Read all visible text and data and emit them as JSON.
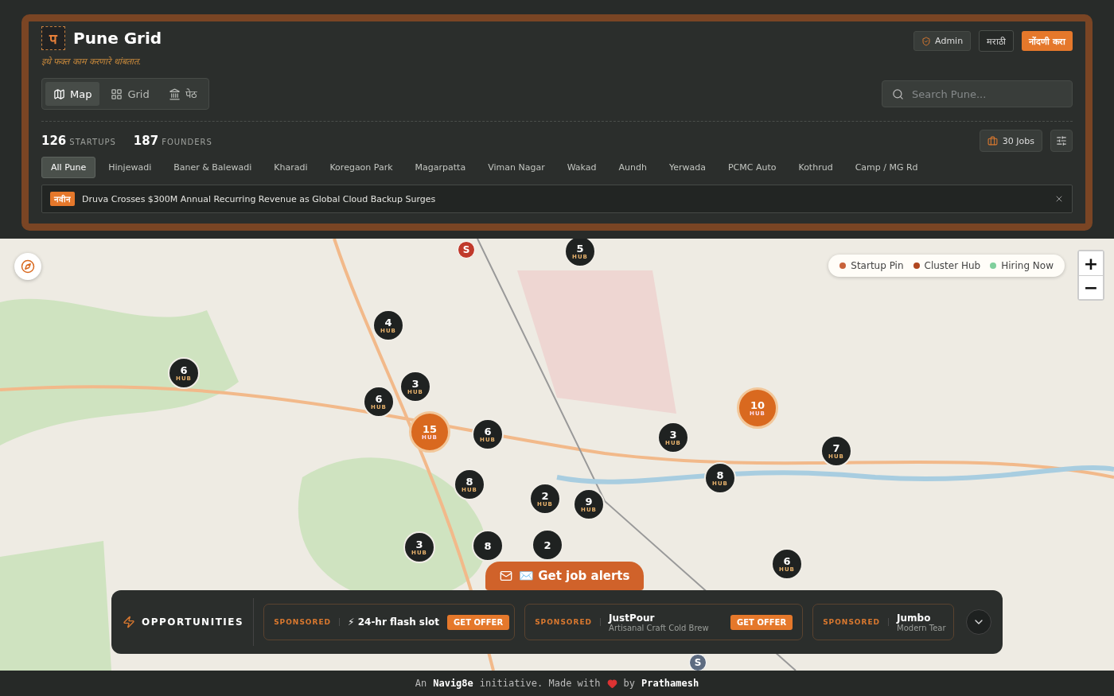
{
  "brand": {
    "logo_letter": "प",
    "name": "Pune Grid",
    "tagline": "इथे फक्त काम करणारे थांबतात."
  },
  "header_buttons": [
    {
      "label": "Admin",
      "kind": "admin"
    },
    {
      "label": "मराठी",
      "kind": "outline"
    },
    {
      "label": "नोंदणी करा",
      "kind": "primary"
    }
  ],
  "view_tabs": [
    {
      "label": "Map",
      "selected": true
    },
    {
      "label": "Grid",
      "selected": false
    },
    {
      "label": "पेठ",
      "selected": false
    }
  ],
  "search": {
    "placeholder": "Search Pune..."
  },
  "stats": [
    {
      "value": "126",
      "label": "STARTUPS"
    },
    {
      "value": "187",
      "label": "FOUNDERS"
    }
  ],
  "jobs_button": "30 Jobs",
  "areas": [
    {
      "label": "All Pune",
      "selected": true
    },
    {
      "label": "Hinjewadi",
      "selected": false
    },
    {
      "label": "Baner & Balewadi",
      "selected": false
    },
    {
      "label": "Kharadi",
      "selected": false
    },
    {
      "label": "Koregaon Park",
      "selected": false
    },
    {
      "label": "Magarpatta",
      "selected": false
    },
    {
      "label": "Viman Nagar",
      "selected": false
    },
    {
      "label": "Wakad",
      "selected": false
    },
    {
      "label": "Aundh",
      "selected": false
    },
    {
      "label": "Yerwada",
      "selected": false
    },
    {
      "label": "PCMC Auto",
      "selected": false
    },
    {
      "label": "Kothrud",
      "selected": false
    },
    {
      "label": "Camp / MG Rd",
      "selected": false
    }
  ],
  "news": {
    "badge": "नवीन",
    "text": "Druva Crosses $300M Annual Recurring Revenue as Global Cloud Backup Surges"
  },
  "legend": [
    {
      "label": "Startup Pin",
      "color": "#c8623a"
    },
    {
      "label": "Cluster Hub",
      "color": "#b0471f"
    },
    {
      "label": "Hiring Now",
      "color": "#7fcf9c"
    }
  ],
  "zoom": {
    "in": "+",
    "out": "−"
  },
  "markers": [
    {
      "kind": "pin",
      "count": "S",
      "highlighted": true
    },
    {
      "kind": "hub",
      "count": "5",
      "unit": "HUB",
      "highlighted": false
    },
    {
      "kind": "hub",
      "count": "4",
      "unit": "HUB",
      "highlighted": false
    },
    {
      "kind": "hub",
      "count": "6",
      "unit": "HUB",
      "highlighted": false
    },
    {
      "kind": "hub",
      "count": "3",
      "unit": "HUB",
      "highlighted": false
    },
    {
      "kind": "hub",
      "count": "6",
      "unit": "HUB",
      "highlighted": false
    },
    {
      "kind": "hub",
      "count": "15",
      "unit": "HUB",
      "highlighted": true
    },
    {
      "kind": "hub",
      "count": "6",
      "unit": "HUB",
      "highlighted": false
    },
    {
      "kind": "hub",
      "count": "10",
      "unit": "HUB",
      "highlighted": true
    },
    {
      "kind": "hub",
      "count": "3",
      "unit": "HUB",
      "highlighted": false
    },
    {
      "kind": "hub",
      "count": "7",
      "unit": "HUB",
      "highlighted": false
    },
    {
      "kind": "hub",
      "count": "8",
      "unit": "HUB",
      "highlighted": false
    },
    {
      "kind": "hub",
      "count": "8",
      "unit": "HUB",
      "highlighted": false
    },
    {
      "kind": "hub",
      "count": "2",
      "unit": "HUB",
      "highlighted": false
    },
    {
      "kind": "hub",
      "count": "9",
      "unit": "HUB",
      "highlighted": false
    },
    {
      "kind": "hub",
      "count": "3",
      "unit": "HUB",
      "highlighted": false
    },
    {
      "kind": "hub",
      "count": "6",
      "unit": "HUB",
      "highlighted": false
    },
    {
      "kind": "pin",
      "count": "S",
      "highlighted": false
    },
    {
      "kind": "hub",
      "count": "8",
      "highlighted": false
    },
    {
      "kind": "hub",
      "count": "2",
      "highlighted": false
    }
  ],
  "alerts_button": "✉️ Get job alerts",
  "opportunities": {
    "title": "OPPORTUNITIES",
    "offers": [
      {
        "tag": "SPONSORED",
        "title": "⚡ 24-hr flash slot",
        "action": "GET OFFER"
      },
      {
        "tag": "SPONSORED",
        "title": "JustPour",
        "subtitle": "Artisanal Craft Cold Brew",
        "action": "GET OFFER"
      },
      {
        "tag": "SPONSORED",
        "title": "Jumbo",
        "subtitle": "Modern Tear"
      }
    ]
  },
  "footer": {
    "pre": "An",
    "brand": "Navig8e",
    "mid": "initiative. Made with",
    "post": "by",
    "author": "Prathamesh"
  }
}
